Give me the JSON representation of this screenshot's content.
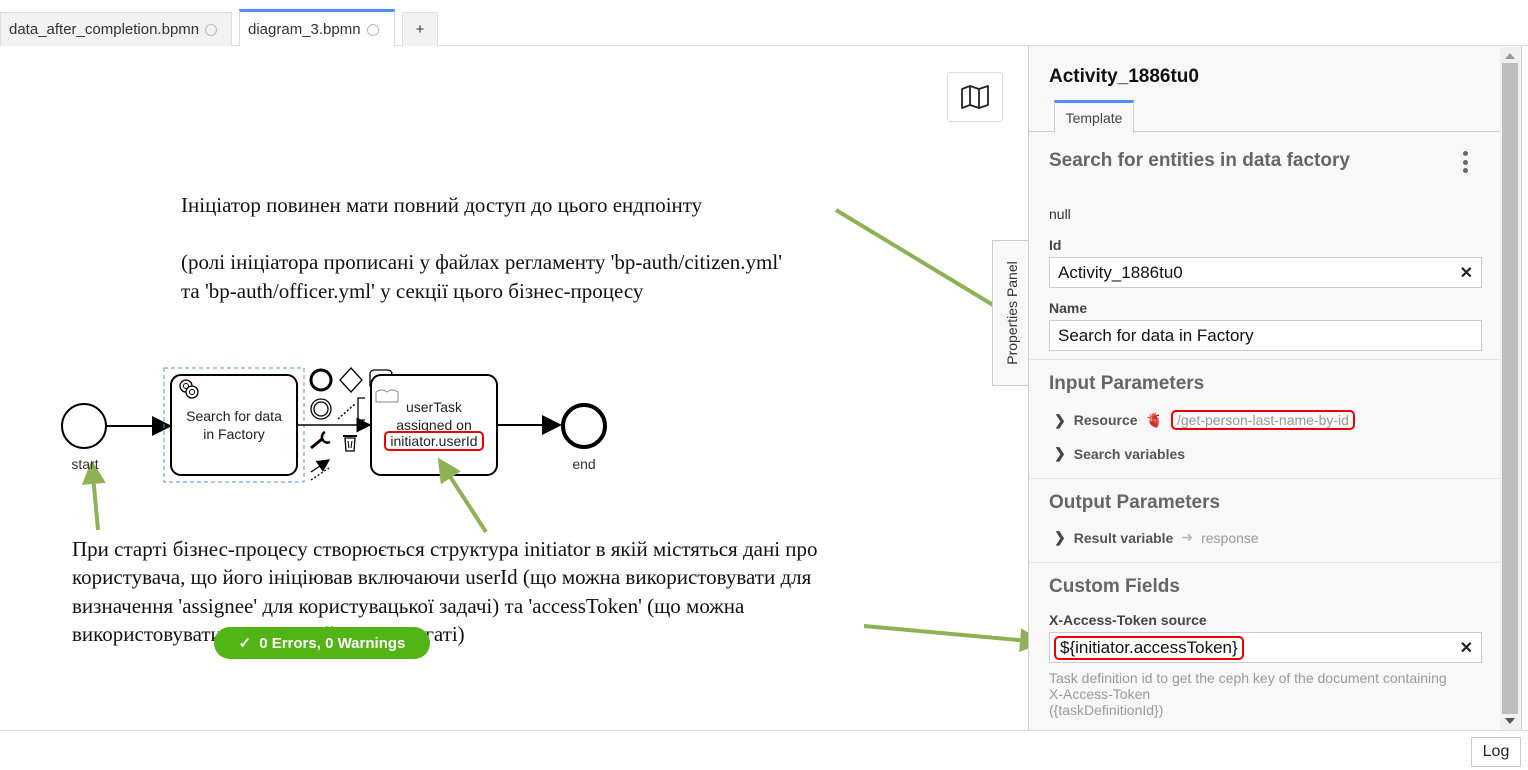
{
  "tabs": [
    {
      "label": "data_after_completion.bpmn",
      "active": false
    },
    {
      "label": "diagram_3.bpmn",
      "active": true
    }
  ],
  "add_tab_label": "+",
  "canvas": {
    "note_top_line1": "Ініціатор повинен мати повний доступ до цього ендпоінту",
    "note_top_line2": "(ролі ініціатора прописані у файлах регламенту 'bp-auth/citizen.yml'",
    "note_top_line3": "та 'bp-auth/officer.yml' у секції цього бізнес-процесу",
    "note_bottom": [
      "При старті бізнес-процесу створюється структура initiator в якій містяться дані про",
      "користувача, що його ініціював включаючи userId (що можна використовувати для",
      "визначення 'assignee' для користувацької задачі) та 'accessToken' (що можна",
      "використовувати у інтеграційному делегаті)"
    ],
    "start_label": "start",
    "end_label": "end",
    "service_task_line1": "Search for data",
    "service_task_line2": "in Factory",
    "user_task_line1": "userTask",
    "user_task_line2": "assigned on",
    "user_task_line3": "initiator.userId",
    "validation_badge": "0 Errors, 0 Warnings",
    "properties_panel_toggle": "Properties Panel",
    "annotation_color": "#8db255",
    "highlight_color": "#e00000"
  },
  "panel": {
    "title": "Activity_1886tu0",
    "tab_label": "Template",
    "template_title": "Search for entities in data factory",
    "null_text": "null",
    "id_label": "Id",
    "id_value": "Activity_1886tu0",
    "name_label": "Name",
    "name_value": "Search for data in Factory",
    "input_params_title": "Input Parameters",
    "resource_label": "Resource",
    "resource_value": "/get-person-last-name-by-id",
    "search_variables_label": "Search variables",
    "output_params_title": "Output Parameters",
    "result_variable_label": "Result variable",
    "result_variable_value": "response",
    "custom_fields_title": "Custom Fields",
    "token_label": "X-Access-Token source",
    "token_value": "${initiator.accessToken}",
    "hint_line1": "Task definition id to get the ceph key of the document containing",
    "hint_line2": "X-Access-Token",
    "hint_line3": "({taskDefinitionId})"
  },
  "log_label": "Log"
}
